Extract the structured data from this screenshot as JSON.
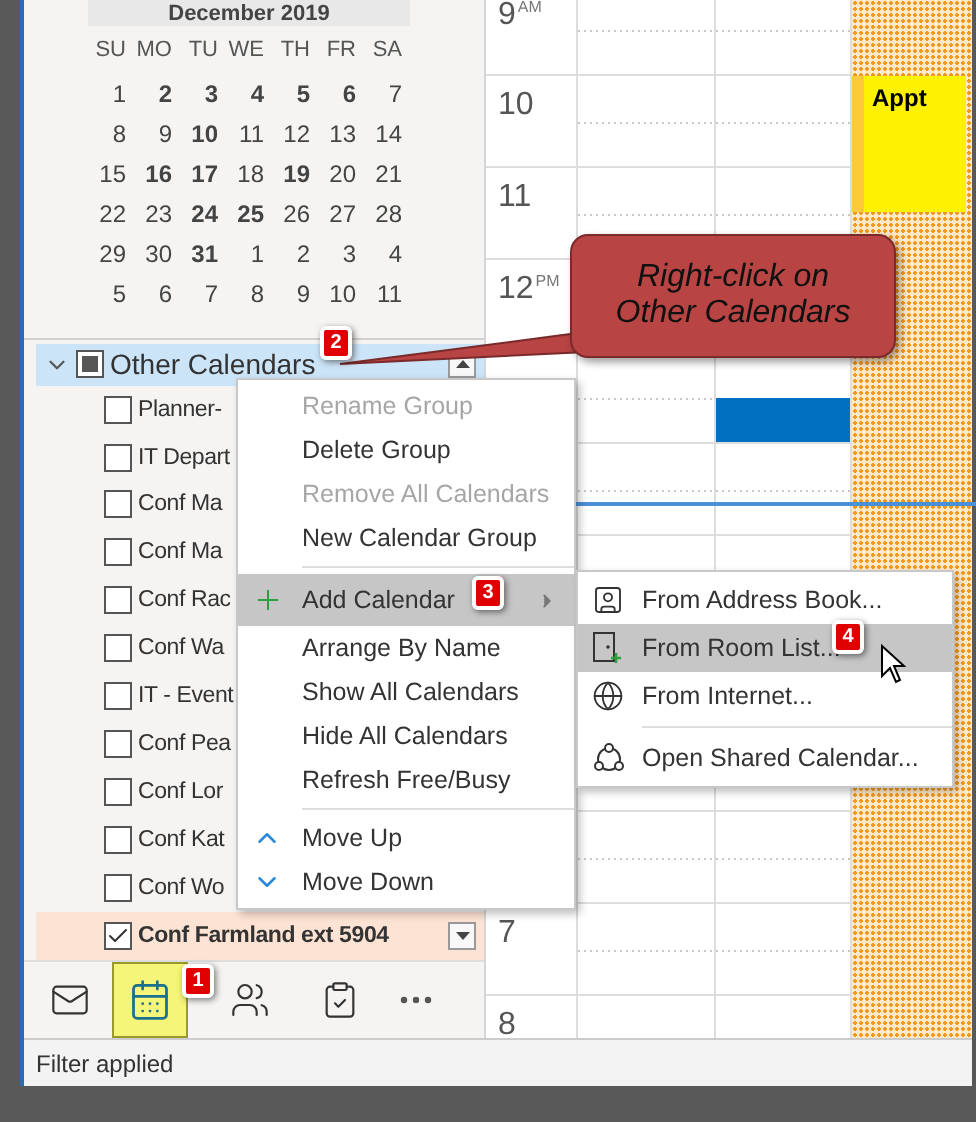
{
  "mini_calendar": {
    "month": "December 2019",
    "weekdays": [
      "SU",
      "MO",
      "TU",
      "WE",
      "TH",
      "FR",
      "SA"
    ],
    "weeks": [
      [
        {
          "d": "1",
          "bold": false
        },
        {
          "d": "2",
          "bold": true
        },
        {
          "d": "3",
          "bold": true
        },
        {
          "d": "4",
          "bold": true
        },
        {
          "d": "5",
          "bold": true
        },
        {
          "d": "6",
          "bold": true
        },
        {
          "d": "7",
          "bold": false
        }
      ],
      [
        {
          "d": "8",
          "bold": false
        },
        {
          "d": "9",
          "bold": false
        },
        {
          "d": "10",
          "bold": true
        },
        {
          "d": "11",
          "bold": false
        },
        {
          "d": "12",
          "bold": false
        },
        {
          "d": "13",
          "bold": false
        },
        {
          "d": "14",
          "bold": false
        }
      ],
      [
        {
          "d": "15",
          "bold": false
        },
        {
          "d": "16",
          "bold": true
        },
        {
          "d": "17",
          "bold": true
        },
        {
          "d": "18",
          "bold": false
        },
        {
          "d": "19",
          "bold": true
        },
        {
          "d": "20",
          "bold": false
        },
        {
          "d": "21",
          "bold": false
        }
      ],
      [
        {
          "d": "22",
          "bold": false
        },
        {
          "d": "23",
          "bold": false
        },
        {
          "d": "24",
          "bold": true
        },
        {
          "d": "25",
          "bold": true
        },
        {
          "d": "26",
          "bold": false
        },
        {
          "d": "27",
          "bold": false
        },
        {
          "d": "28",
          "bold": false
        }
      ],
      [
        {
          "d": "29",
          "bold": false
        },
        {
          "d": "30",
          "bold": false
        },
        {
          "d": "31",
          "bold": true
        },
        {
          "d": "1",
          "bold": false
        },
        {
          "d": "2",
          "bold": false
        },
        {
          "d": "3",
          "bold": false
        },
        {
          "d": "4",
          "bold": false
        }
      ],
      [
        {
          "d": "5",
          "bold": false
        },
        {
          "d": "6",
          "bold": false
        },
        {
          "d": "7",
          "bold": false
        },
        {
          "d": "8",
          "bold": false
        },
        {
          "d": "9",
          "bold": false
        },
        {
          "d": "10",
          "bold": false
        },
        {
          "d": "11",
          "bold": false
        }
      ]
    ]
  },
  "calendars": {
    "group": "Other Calendars",
    "expanded": true,
    "items": [
      {
        "label": "Planner-",
        "checked": false,
        "selected": false
      },
      {
        "label": "IT Depart",
        "checked": false,
        "selected": false
      },
      {
        "label": "Conf Ma",
        "checked": false,
        "selected": false
      },
      {
        "label": "Conf Ma",
        "checked": false,
        "selected": false
      },
      {
        "label": "Conf Rac",
        "checked": false,
        "selected": false
      },
      {
        "label": "Conf Wa",
        "checked": false,
        "selected": false
      },
      {
        "label": "IT - Event",
        "checked": false,
        "selected": false
      },
      {
        "label": "Conf Pea",
        "checked": false,
        "selected": false
      },
      {
        "label": "Conf Lor",
        "checked": false,
        "selected": false
      },
      {
        "label": "Conf Kat",
        "checked": false,
        "selected": false
      },
      {
        "label": "Conf Wo",
        "checked": false,
        "selected": false
      },
      {
        "label": "Conf Farmland ext 5904",
        "checked": true,
        "selected": true
      }
    ]
  },
  "nav": [
    {
      "kind": "mail",
      "selected": false
    },
    {
      "kind": "calendar",
      "selected": true
    },
    {
      "kind": "people",
      "selected": false
    },
    {
      "kind": "tasks",
      "selected": false
    },
    {
      "kind": "more",
      "selected": false
    }
  ],
  "status_bar": "Filter applied",
  "hours_top": [
    {
      "label": "9",
      "suffix": "AM"
    },
    {
      "label": "10"
    },
    {
      "label": "11"
    },
    {
      "label": "12",
      "suffix": "PM"
    }
  ],
  "hours_bottom": [
    {
      "label": "7"
    },
    {
      "label": "8"
    }
  ],
  "appointment": {
    "title": "Appt"
  },
  "context_menu": [
    {
      "kind": "item",
      "label": "Rename Group",
      "disabled": true,
      "selected": false
    },
    {
      "kind": "item",
      "label": "Delete Group",
      "disabled": false,
      "selected": false
    },
    {
      "kind": "item",
      "label": "Remove All Calendars",
      "disabled": true,
      "selected": false
    },
    {
      "kind": "item",
      "label": "New Calendar Group",
      "disabled": false,
      "selected": false
    },
    {
      "kind": "separator"
    },
    {
      "kind": "item",
      "label": "Add Calendar",
      "disabled": false,
      "selected": true,
      "submenu": true
    },
    {
      "kind": "item",
      "label": "Arrange By Name",
      "disabled": false,
      "selected": false
    },
    {
      "kind": "item",
      "label": "Show All Calendars",
      "disabled": false,
      "selected": false
    },
    {
      "kind": "item",
      "label": "Hide All Calendars",
      "disabled": false,
      "selected": false
    },
    {
      "kind": "item",
      "label": "Refresh Free/Busy",
      "disabled": false,
      "selected": false
    },
    {
      "kind": "separator"
    },
    {
      "kind": "item",
      "label": "Move Up",
      "disabled": false,
      "selected": false
    },
    {
      "kind": "item",
      "label": "Move Down",
      "disabled": false,
      "selected": false
    }
  ],
  "submenu": [
    {
      "kind": "item",
      "label": "From Address Book...",
      "selected": false
    },
    {
      "kind": "item",
      "label": "From Room List...",
      "selected": true
    },
    {
      "kind": "item",
      "label": "From Internet...",
      "selected": false
    },
    {
      "kind": "separator"
    },
    {
      "kind": "item",
      "label": "Open Shared Calendar...",
      "selected": false
    }
  ],
  "callout": "Right-click on Other Calendars",
  "badges": [
    "1",
    "2",
    "3",
    "4"
  ]
}
